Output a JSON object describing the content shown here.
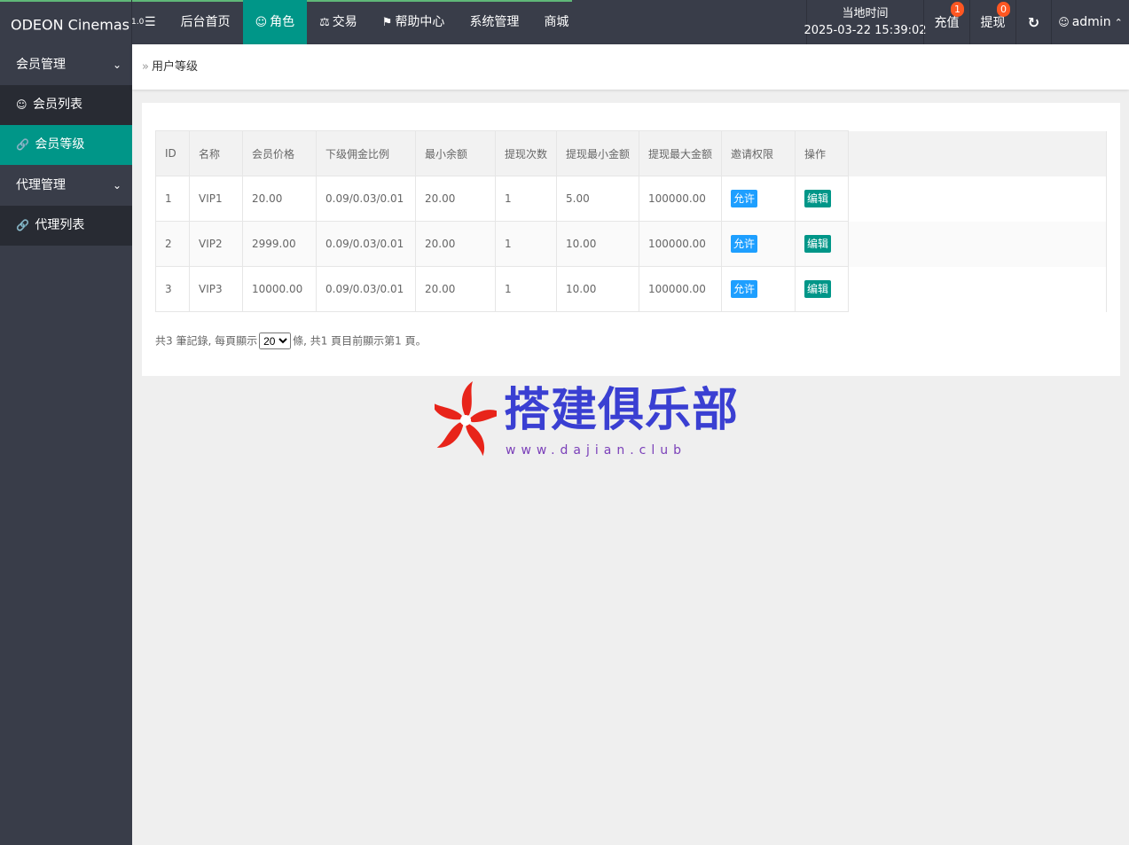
{
  "header": {
    "logo": "ODEON Cinemas",
    "version": "1.0",
    "menu_toggle": "☰",
    "nav": [
      {
        "label": "后台首页",
        "icon": ""
      },
      {
        "label": "角色",
        "icon": "user-icon"
      },
      {
        "label": "交易",
        "icon": "scale-icon"
      },
      {
        "label": "帮助中心",
        "icon": "flag-icon"
      },
      {
        "label": "系统管理",
        "icon": ""
      },
      {
        "label": "商城",
        "icon": ""
      }
    ],
    "time_label": "当地时间",
    "time_value": "2025-03-22 15:39:02",
    "recharge": "充值",
    "recharge_badge": "1",
    "withdraw": "提现",
    "withdraw_badge": "0",
    "refresh_icon": "refresh-icon",
    "admin": "admin"
  },
  "sidebar": {
    "groups": [
      {
        "label": "会员管理",
        "items": [
          {
            "label": "会员列表",
            "icon": "user-icon"
          },
          {
            "label": "会员等级",
            "icon": "link-icon",
            "active": true
          }
        ]
      },
      {
        "label": "代理管理",
        "items": [
          {
            "label": "代理列表",
            "icon": "link-icon"
          }
        ]
      }
    ]
  },
  "breadcrumb": "用户等级",
  "table": {
    "columns": [
      "ID",
      "名称",
      "会员价格",
      "下级佣金比例",
      "最小余额",
      "提现次数",
      "提现最小金额",
      "提现最大金额",
      "邀请权限",
      "操作"
    ],
    "rows": [
      {
        "id": "1",
        "name": "VIP1",
        "price": "20.00",
        "ratio": "0.09/0.03/0.01",
        "min_balance": "20.00",
        "count": "1",
        "min_withdraw": "5.00",
        "max_withdraw": "100000.00",
        "permission": "允许",
        "action": "编辑"
      },
      {
        "id": "2",
        "name": "VIP2",
        "price": "2999.00",
        "ratio": "0.09/0.03/0.01",
        "min_balance": "20.00",
        "count": "1",
        "min_withdraw": "10.00",
        "max_withdraw": "100000.00",
        "permission": "允许",
        "action": "编辑"
      },
      {
        "id": "3",
        "name": "VIP3",
        "price": "10000.00",
        "ratio": "0.09/0.03/0.01",
        "min_balance": "20.00",
        "count": "1",
        "min_withdraw": "10.00",
        "max_withdraw": "100000.00",
        "permission": "允许",
        "action": "编辑"
      }
    ]
  },
  "pager": {
    "prefix": "共3 筆記錄, 每頁顯示",
    "page_size": "20",
    "suffix": "條, 共1 頁目前顯示第1 頁。"
  },
  "watermark": {
    "text": "搭建俱乐部",
    "url": "www.dajian.club"
  },
  "colors": {
    "header_bg": "#393d49",
    "accent": "#009688",
    "allow_btn": "#1e9fff",
    "badge": "#ff5722"
  }
}
